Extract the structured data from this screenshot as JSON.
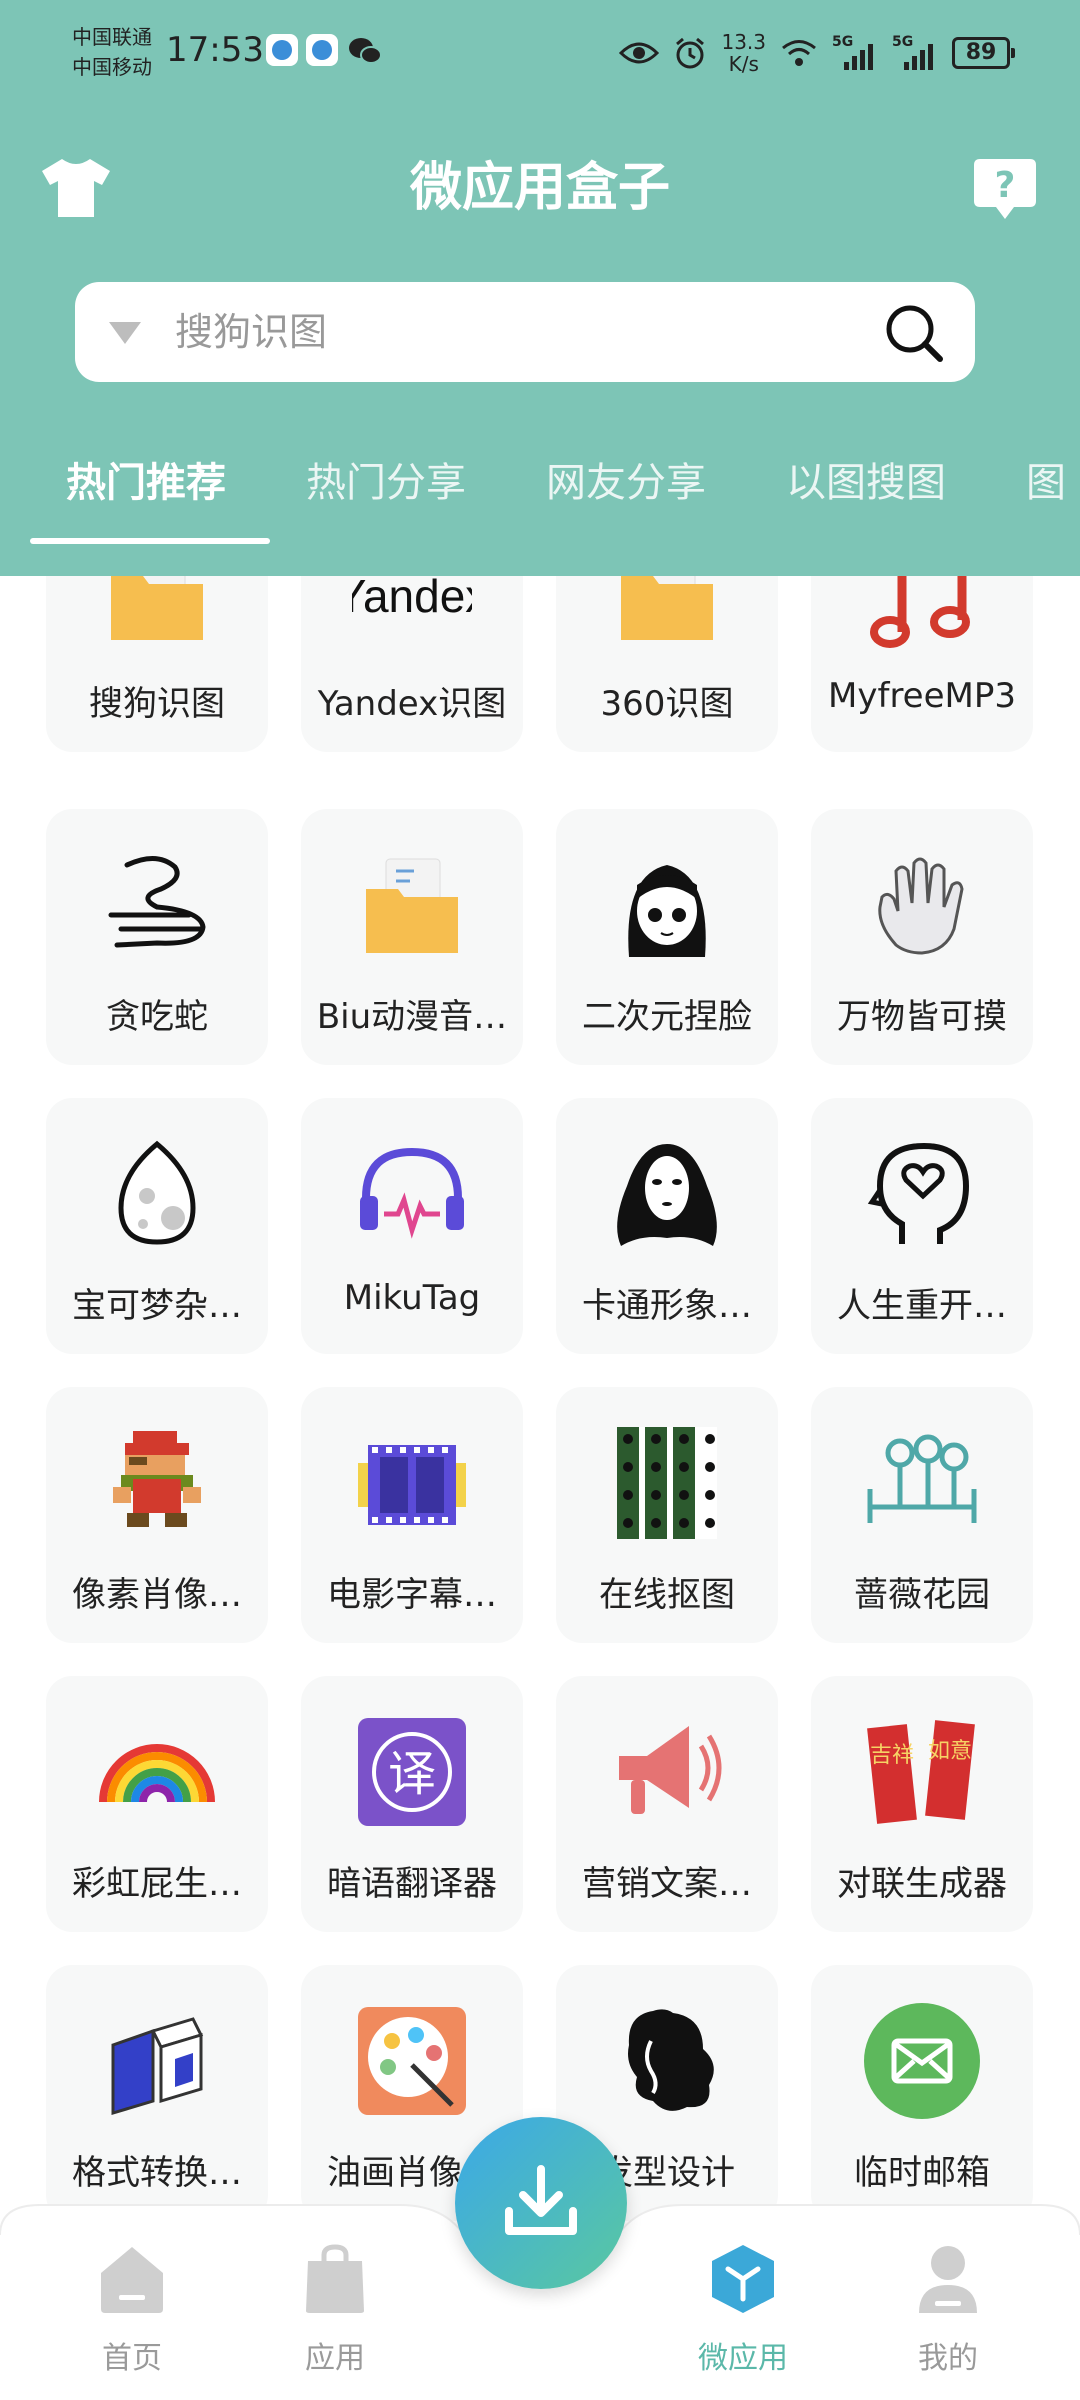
{
  "status_bar": {
    "carrier_1": "中国联通",
    "carrier_2": "中国移动",
    "time": "17:53",
    "net_speed_value": "13.3",
    "net_speed_unit": "K/s",
    "signal_1": "5G",
    "signal_2": "5G",
    "battery": "89"
  },
  "header": {
    "title": "微应用盒子",
    "left_icon": "tshirt-icon",
    "right_icon": "help-icon"
  },
  "search": {
    "placeholder": "搜狗识图",
    "value": ""
  },
  "tabs": [
    {
      "label": "热门推荐",
      "active": true
    },
    {
      "label": "热门分享",
      "active": false
    },
    {
      "label": "网友分享",
      "active": false
    },
    {
      "label": "以图搜图",
      "active": false
    },
    {
      "label": "图",
      "active": false
    }
  ],
  "apps": [
    {
      "label": "搜狗识图",
      "icon": "folder-icon"
    },
    {
      "label": "Yandex识图",
      "icon": "yandex-logo",
      "logo_text": "Yandex"
    },
    {
      "label": "360识图",
      "icon": "folder-icon"
    },
    {
      "label": "MyfreeMP3",
      "icon": "music-note-icon"
    },
    {
      "label": "贪吃蛇",
      "icon": "snake-icon"
    },
    {
      "label": "Biu动漫音…",
      "icon": "folder-icon"
    },
    {
      "label": "二次元捏脸",
      "icon": "anime-girl-icon"
    },
    {
      "label": "万物皆可摸",
      "icon": "hand-icon"
    },
    {
      "label": "宝可梦杂…",
      "icon": "egg-icon"
    },
    {
      "label": "MikuTag",
      "icon": "headphones-icon"
    },
    {
      "label": "卡通形象…",
      "icon": "no-face-icon"
    },
    {
      "label": "人生重开…",
      "icon": "head-heart-icon"
    },
    {
      "label": "像素肖像…",
      "icon": "pixel-character-icon"
    },
    {
      "label": "电影字幕…",
      "icon": "film-strip-icon"
    },
    {
      "label": "在线抠图",
      "icon": "cutout-grid-icon"
    },
    {
      "label": "蔷薇花园",
      "icon": "garden-icon"
    },
    {
      "label": "彩虹屁生…",
      "icon": "rainbow-icon"
    },
    {
      "label": "暗语翻译器",
      "icon": "translate-icon",
      "logo_text": "译"
    },
    {
      "label": "营销文案…",
      "icon": "megaphone-icon"
    },
    {
      "label": "对联生成器",
      "icon": "couplet-icon",
      "logo_text_1": "吉祥",
      "logo_text_2": "如意"
    },
    {
      "label": "格式转换…",
      "icon": "format-convert-icon"
    },
    {
      "label": "油画肖像…",
      "icon": "palette-icon"
    },
    {
      "label": "发型设计",
      "icon": "hairstyle-icon"
    },
    {
      "label": "临时邮箱",
      "icon": "mail-icon"
    }
  ],
  "bottom_nav": [
    {
      "label": "首页",
      "icon": "home-icon",
      "active": false
    },
    {
      "label": "应用",
      "icon": "bag-icon",
      "active": false
    },
    {
      "label": "微应用",
      "icon": "cube-icon",
      "active": true
    },
    {
      "label": "我的",
      "icon": "user-icon",
      "active": false
    }
  ],
  "fab": {
    "icon": "download-icon"
  },
  "colors": {
    "header": "#7DC5B6",
    "card": "#F7F8F8",
    "nav_active": "#5BB8A9",
    "nav_inactive": "#9A9A9A"
  }
}
